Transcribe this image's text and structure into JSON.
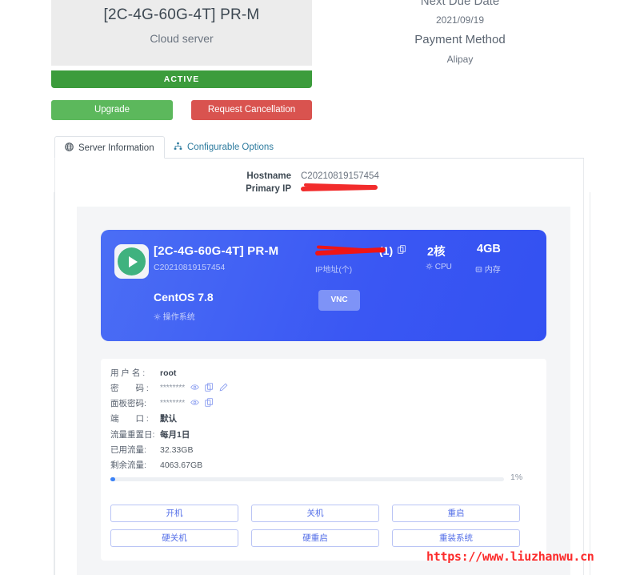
{
  "product": {
    "title": "[2C-4G-60G-4T] PR-M",
    "subtitle": "Cloud server",
    "status": "ACTIVE"
  },
  "billing": {
    "next_due_date_label": "Next Due Date",
    "next_due_date": "2021/09/19",
    "payment_method_label": "Payment Method",
    "payment_method": "Alipay"
  },
  "actions": {
    "upgrade": "Upgrade",
    "request_cancellation": "Request Cancellation"
  },
  "tabs": [
    {
      "label": "Server Information",
      "icon": "globe-icon",
      "active": true
    },
    {
      "label": "Configurable Options",
      "icon": "sitemap-icon",
      "active": false
    }
  ],
  "host": {
    "hostname_label": "Hostname",
    "hostname": "C20210819157454",
    "primary_ip_label": "Primary IP",
    "primary_ip": ""
  },
  "server_card": {
    "name": "[2C-4G-60G-4T] PR-M",
    "id": "C20210819157454",
    "ip_masked": "",
    "ip_count": "(1)",
    "ip_label": "IP地址(个)",
    "cpu_value": "2核",
    "cpu_label": "CPU",
    "mem_value": "4GB",
    "mem_label": "内存",
    "os_value": "CentOS 7.8",
    "os_label": "操作系统",
    "vnc_button": "VNC"
  },
  "details": {
    "username_label": "用 户 名 :",
    "username": "root",
    "password_label": "密　　码 :",
    "password": "********",
    "panel_password_label": "面板密码:",
    "panel_password": "********",
    "port_label": "端　　口 :",
    "port": "默认",
    "reset_day_label": "流量重置日:",
    "reset_day": "每月1日",
    "used_traffic_label": "已用流量:",
    "used_traffic": "32.33GB",
    "remaining_traffic_label": "剩余流量:",
    "remaining_traffic": "4063.67GB",
    "progress_percent": "1%"
  },
  "operations": [
    {
      "label": "开机"
    },
    {
      "label": "关机"
    },
    {
      "label": "重启"
    },
    {
      "label": "硬关机"
    },
    {
      "label": "硬重启"
    },
    {
      "label": "重装系统"
    }
  ],
  "watermark": "https://www.liuzhanwu.cn",
  "colors": {
    "status_green": "#3c9c3c",
    "upgrade_green": "#5cb85c",
    "cancel_red": "#d9534f",
    "card_blue": "#3a57f3",
    "accent_blue": "#5570e8",
    "redaction_red": "#f01515",
    "watermark_red": "#fc2b2b"
  }
}
